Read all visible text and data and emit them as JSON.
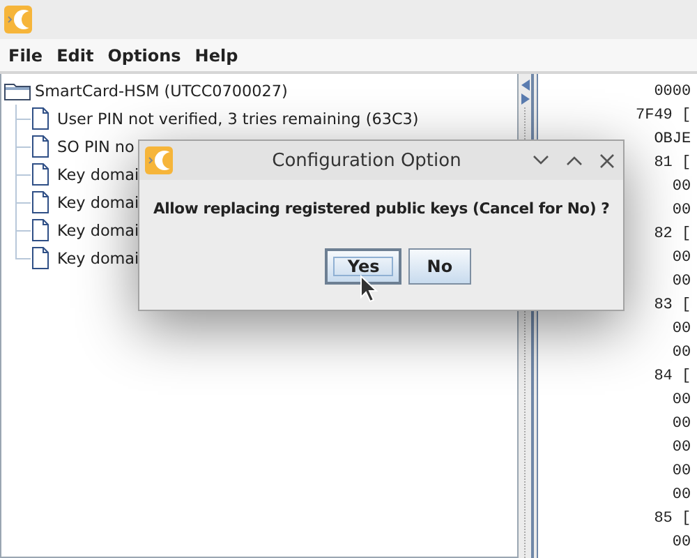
{
  "menu": [
    {
      "label": "File"
    },
    {
      "label": "Edit"
    },
    {
      "label": "Options"
    },
    {
      "label": "Help"
    }
  ],
  "tree": {
    "label": "SmartCard-HSM (UTCC0700027)",
    "children": [
      {
        "label": "User PIN not verified, 3 tries remaining (63C3)"
      },
      {
        "label": "SO PIN no"
      },
      {
        "label": "Key domai"
      },
      {
        "label": "Key domai"
      },
      {
        "label": "Key domai"
      },
      {
        "label": "Key domai"
      }
    ]
  },
  "hex_view": {
    "lines": [
      "  0000",
      "7F49 [",
      "  OBJE",
      "  81 [",
      "    00",
      "    00",
      "  82 [",
      "    00",
      "    00",
      "  83 [",
      "    00",
      "    00",
      "  84 [",
      "    00",
      "    00",
      "    00",
      "    00",
      "    00",
      "  85 [",
      "    00"
    ]
  },
  "dialog": {
    "title": "Configuration Option",
    "message": "Allow replacing registered public keys (Cancel for No) ?",
    "buttons": [
      {
        "label": "Yes",
        "focused": true
      },
      {
        "label": "No",
        "focused": false
      }
    ]
  }
}
